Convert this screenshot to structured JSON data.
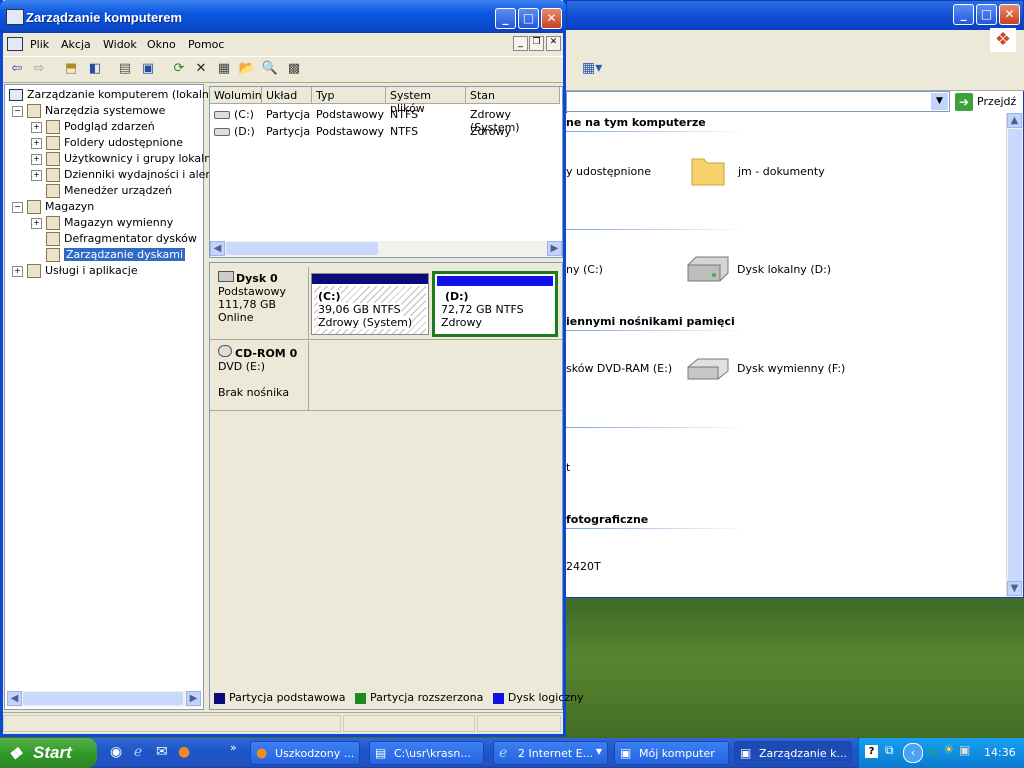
{
  "main_window": {
    "title": "Zarządzanie komputerem",
    "menu": [
      "Plik",
      "Akcja",
      "Widok",
      "Okno",
      "Pomoc"
    ]
  },
  "tree": {
    "root": "Zarządzanie komputerem (lokalne)",
    "items": [
      {
        "label": "Narzędzia systemowe",
        "level": 1,
        "expander": "−"
      },
      {
        "label": "Podgląd zdarzeń",
        "level": 2,
        "expander": "+"
      },
      {
        "label": "Foldery udostępnione",
        "level": 2,
        "expander": "+"
      },
      {
        "label": "Użytkownicy i grupy lokalne",
        "level": 2,
        "expander": "+"
      },
      {
        "label": "Dzienniki wydajności i alerty",
        "level": 2,
        "expander": "+"
      },
      {
        "label": "Menedżer urządzeń",
        "level": 2,
        "expander": ""
      },
      {
        "label": "Magazyn",
        "level": 1,
        "expander": "−"
      },
      {
        "label": "Magazyn wymienny",
        "level": 2,
        "expander": "+"
      },
      {
        "label": "Defragmentator dysków",
        "level": 2,
        "expander": ""
      },
      {
        "label": "Zarządzanie dyskami",
        "level": 2,
        "expander": "",
        "selected": true
      },
      {
        "label": "Usługi i aplikacje",
        "level": 1,
        "expander": "+"
      }
    ]
  },
  "volume_table": {
    "headers": [
      "Wolumin",
      "Układ",
      "Typ",
      "System plików",
      "Stan"
    ],
    "rows": [
      [
        "(C:)",
        "Partycja",
        "Podstawowy",
        "NTFS",
        "Zdrowy (System)"
      ],
      [
        "(D:)",
        "Partycja",
        "Podstawowy",
        "NTFS",
        "Zdrowy"
      ]
    ]
  },
  "disks": {
    "disk0": {
      "name": "Dysk 0",
      "type": "Podstawowy",
      "size": "111,78 GB",
      "status": "Online"
    },
    "partC": {
      "name": "(C:)",
      "size": "39,06 GB NTFS",
      "status": "Zdrowy (System)"
    },
    "partD": {
      "name": "(D:)",
      "size": "72,72 GB NTFS",
      "status": "Zdrowy"
    },
    "cdrom": {
      "name": "CD-ROM 0",
      "type": "DVD (E:)",
      "status": "Brak nośnika"
    }
  },
  "legend": [
    "Partycja podstawowa",
    "Partycja rozszerzona",
    "Dysk logiczny"
  ],
  "colors": {
    "primary": "#0a0a7a",
    "extended": "#1e8a1e",
    "logical": "#1010e8"
  },
  "bg_window": {
    "go_label": "Przejdź",
    "sections": [
      "ne na tym komputerze",
      "iennymi nośnikami pamięci",
      "fotograficzne"
    ],
    "items": [
      "y udostępnione",
      "jm - dokumenty",
      "ny (C:)",
      "Dysk lokalny (D:)",
      "sków DVD-RAM (E:)",
      "Dysk wymienny (F:)",
      "t",
      "2420T"
    ]
  },
  "taskbar": {
    "start": "Start",
    "tasks": [
      "Uszkodzony ...",
      "C:\\usr\\krasn...",
      "2 Internet E...",
      "Mój komputer",
      "Zarządzanie k..."
    ],
    "clock": "14:36"
  }
}
